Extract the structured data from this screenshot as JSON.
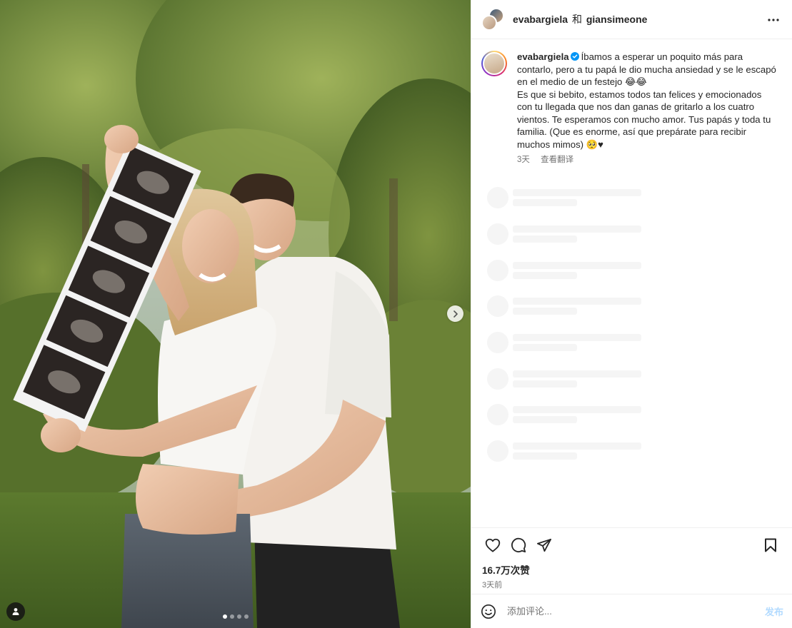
{
  "header": {
    "user1": "evabargiela",
    "joiner": "和",
    "user2": "giansimeone"
  },
  "caption": {
    "username": "evabargiela",
    "line1": "Íbamos a esperar un poquito más para contarlo, pero a tu papá le dio mucha ansiedad y se le escapó en el medio de un festejo 😂😂",
    "line2": "Es que si bebito, estamos todos tan felices y emocionados con tu llegada que nos dan ganas de gritarlo a los cuatro vientos. Te esperamos con mucho amor. Tus papás y toda tu familia. (Que es enorme, así que prepárate para recibir muchos mimos) 🥺♥",
    "age": "3天",
    "translate_label": "查看翻译"
  },
  "stats": {
    "likes": "16.7万次赞",
    "date": "3天前"
  },
  "comment": {
    "placeholder": "添加评论...",
    "post_label": "发布"
  },
  "carousel": {
    "total": 4,
    "current": 1
  },
  "icons": {
    "more": "more-horizontal-icon",
    "like": "heart-icon",
    "comment": "comment-icon",
    "share": "share-icon",
    "save": "bookmark-icon",
    "emoji": "emoji-icon",
    "next": "chevron-right-icon",
    "tag": "user-tag-icon",
    "verified": "verified-badge-icon"
  },
  "colors": {
    "verified": "#0095f6",
    "post_disabled": "#b3dbff",
    "secondary_text": "#737373"
  }
}
